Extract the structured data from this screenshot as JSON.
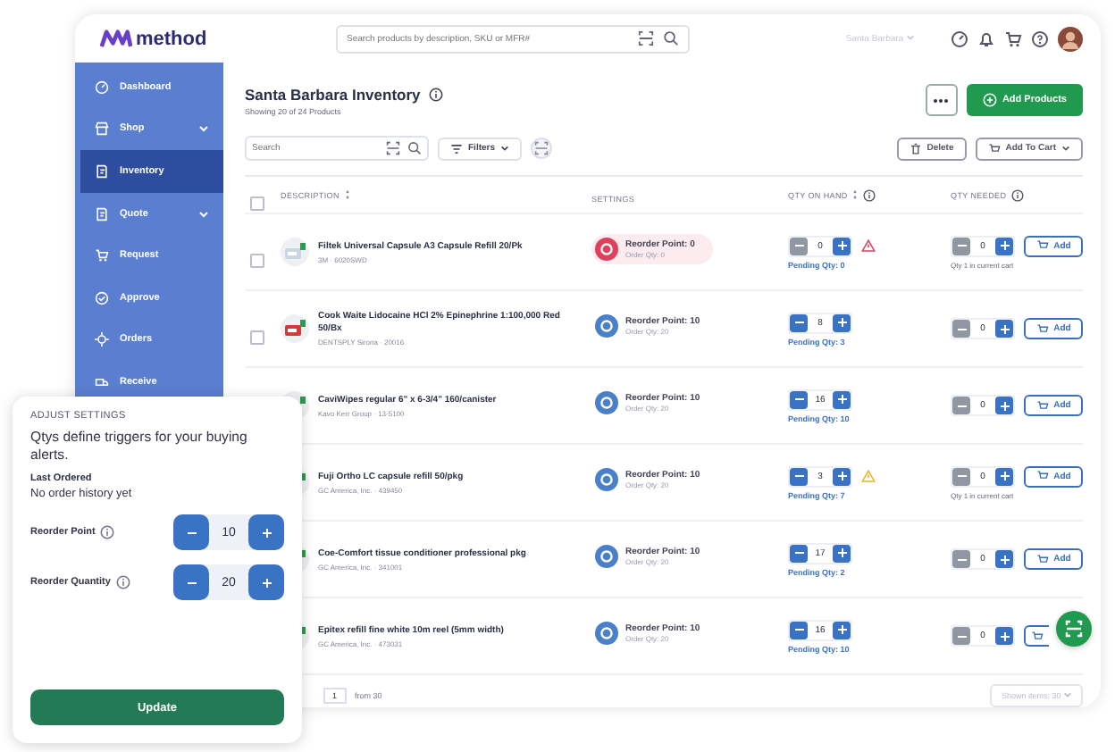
{
  "brand": "method",
  "header": {
    "search_placeholder": "Search products by description, SKU or MFR#",
    "location": "Santa Barbara"
  },
  "sidebar": {
    "items": [
      {
        "kind": "dashboard",
        "label": "Dashboard",
        "expandable": false,
        "selected": false
      },
      {
        "kind": "shop",
        "label": "Shop",
        "expandable": true,
        "selected": false
      },
      {
        "kind": "inventory",
        "label": "Inventory",
        "expandable": false,
        "selected": true
      },
      {
        "kind": "quote",
        "label": "Quote",
        "expandable": true,
        "selected": false
      },
      {
        "kind": "request",
        "label": "Request",
        "expandable": false,
        "selected": false
      },
      {
        "kind": "approve",
        "label": "Approve",
        "expandable": false,
        "selected": false
      },
      {
        "kind": "orders",
        "label": "Orders",
        "expandable": false,
        "selected": false
      },
      {
        "kind": "receive",
        "label": "Receive",
        "expandable": false,
        "selected": false
      }
    ]
  },
  "page": {
    "title": "Santa Barbara Inventory",
    "subtitle": "Showing 20 of 24 Products",
    "add_products": "Add Products"
  },
  "toolbar": {
    "search_placeholder": "Search",
    "filters": "Filters",
    "delete": "Delete",
    "add_to_cart": "Add To Cart"
  },
  "table": {
    "all_checked": false,
    "columns": [
      "DESCRIPTION",
      "SETTINGS",
      "QTY ON HAND",
      "QTY NEEDED"
    ],
    "rows": [
      {
        "name": "Filtek Universal Capsule A3 Capsule Refill 20/Pk",
        "sub": "3M · 6020SWD",
        "below_point": true,
        "reorder": "Reorder Point: 0",
        "order_qty": "Order Qty: 0",
        "checked": false,
        "on_hand": "0",
        "on_hand_min_disabled": true,
        "pending": "Pending Qty: 0",
        "stock_alert": true,
        "critical": true,
        "needed": "0",
        "cart_note": "Qty 1 in current cart",
        "add_label": "Add"
      },
      {
        "name": "Cook Waite Lidocaine HCl 2% Epinephrine 1:100,000 Red 50/Bx",
        "sub": "DENTSPLY Sirona · 20016",
        "below_point": false,
        "reorder": "Reorder Point: 10",
        "order_qty": "Order Qty: 20",
        "checked": false,
        "on_hand": "8",
        "on_hand_min_disabled": false,
        "pending": "Pending Qty: 3",
        "stock_alert": false,
        "needed": "0",
        "add_label": "Add"
      },
      {
        "name": "CaviWipes regular 6\" x 6-3/4\" 160/canister",
        "sub": "Kavo Kerr Group · 13-5100",
        "below_point": false,
        "reorder": "Reorder Point: 10",
        "order_qty": "Order Qty: 20",
        "on_hand": "16",
        "on_hand_min_disabled": false,
        "pending": "Pending Qty: 10",
        "stock_alert": false,
        "needed": "0",
        "add_label": "Add"
      },
      {
        "name": "Fuji Ortho LC capsule refill 50/pkg",
        "sub": "GC America, Inc. · 439450",
        "below_point": false,
        "reorder": "Reorder Point: 10",
        "order_qty": "Order Qty: 20",
        "on_hand": "3",
        "on_hand_min_disabled": false,
        "pending": "Pending Qty: 7",
        "stock_alert": true,
        "critical": false,
        "needed": "0",
        "cart_note": "Qty 1 in current cart",
        "add_label": "Add"
      },
      {
        "name": "Coe-Comfort tissue conditioner professional pkg",
        "sub": "GC America, Inc. · 341001",
        "below_point": false,
        "reorder": "Reorder Point: 10",
        "order_qty": "Order Qty: 20",
        "on_hand": "17",
        "on_hand_min_disabled": false,
        "pending": "Pending Qty: 2",
        "stock_alert": false,
        "needed": "0",
        "add_label": "Add"
      },
      {
        "name": "Epitex refill fine white 10m reel (5mm width)",
        "sub": "GC America, Inc. · 473031",
        "below_point": false,
        "reorder": "Reorder Point: 10",
        "order_qty": "Order Qty: 20",
        "on_hand": "16",
        "on_hand_min_disabled": false,
        "pending": "Pending Qty: 10",
        "stock_alert": false,
        "needed": "0"
      }
    ]
  },
  "pagination": {
    "page": "1",
    "total": "from 30",
    "shown": "Shown items: 30"
  },
  "popup": {
    "heading": "ADJUST SETTINGS",
    "text": "Qtys define triggers for your buying alerts.",
    "last_label": "Last Ordered",
    "last_value": "No order history yet",
    "fields": [
      {
        "label": "Reorder Point",
        "value": "10"
      },
      {
        "label": "Reorder Quantity",
        "value": "20"
      }
    ],
    "button": "Update"
  }
}
